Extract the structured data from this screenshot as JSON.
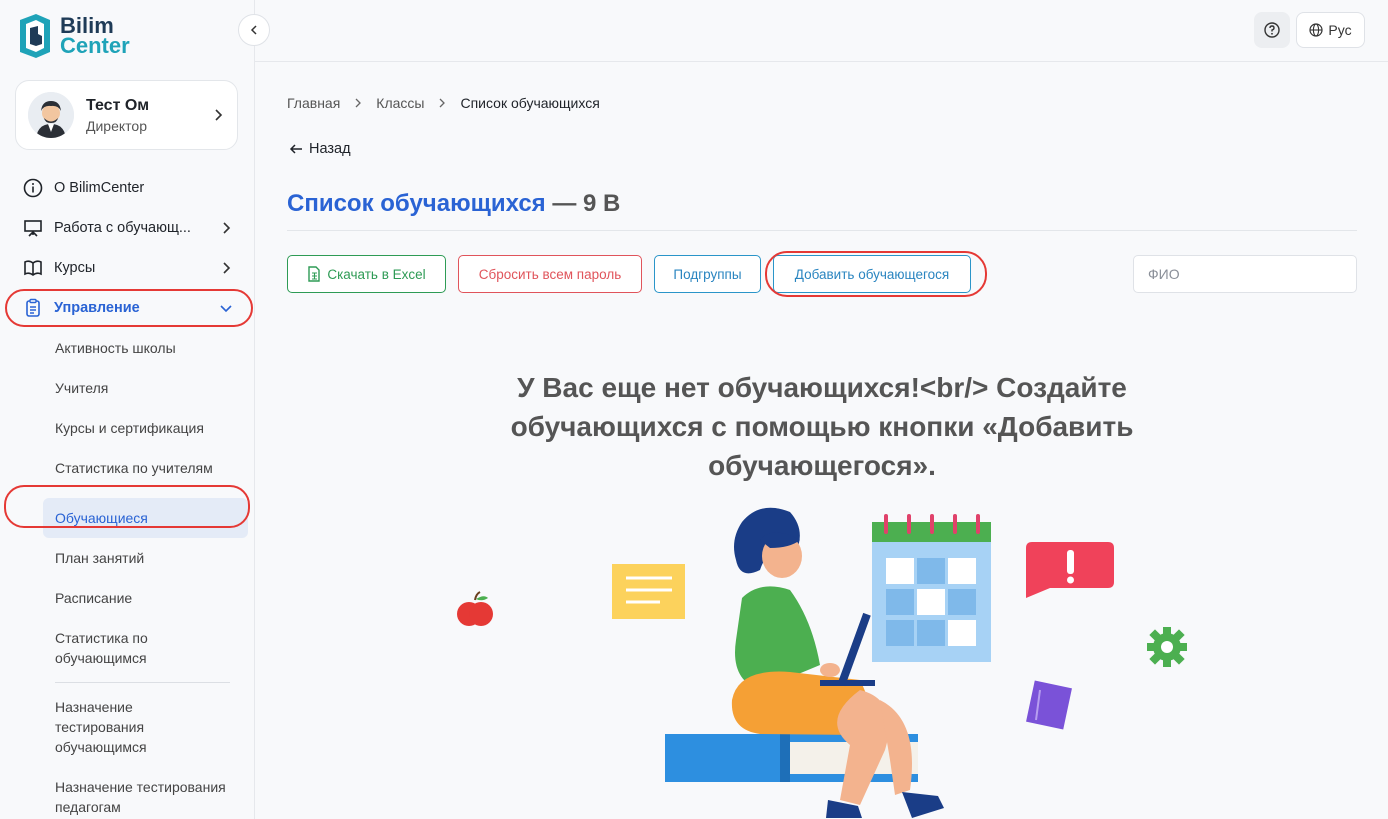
{
  "logo": {
    "line1": "Bilim",
    "line2": "Center"
  },
  "profile": {
    "name": "Тест Ом",
    "role": "Директор"
  },
  "nav": {
    "about": "О BilimCenter",
    "students_work": "Работа с обучающ...",
    "courses": "Курсы",
    "management": "Управление"
  },
  "sub": {
    "school_activity": "Активность школы",
    "teachers": "Учителя",
    "courses_cert": "Курсы и сертификация",
    "teacher_stats": "Статистика по учителям",
    "students": "Обучающиеся",
    "lesson_plan": "План занятий",
    "schedule": "Расписание",
    "student_stats": "Статистика по обучающимся",
    "assign_students": "Назначение тестирования обучающимся",
    "assign_teachers": "Назначение тестирования педагогам"
  },
  "topbar": {
    "lang": "Рус"
  },
  "breadcrumb": {
    "home": "Главная",
    "classes": "Классы",
    "current": "Список обучающихся"
  },
  "back_label": "Назад",
  "page_title": {
    "main": "Список обучающихся",
    "suffix": "— 9 В"
  },
  "actions": {
    "excel": "Скачать в Excel",
    "reset": "Сбросить всем пароль",
    "subgroups": "Подгруппы",
    "add": "Добавить обучающегося"
  },
  "search": {
    "placeholder": "ФИО"
  },
  "empty_message": "У Вас еще нет обучающихся!<br/> Создайте обучающихся с помощью кнопки «Добавить обучающегося».",
  "colors": {
    "primary": "#2a63d4",
    "danger": "#e0545b",
    "success": "#2e9b55",
    "highlight_ring": "#e53935"
  }
}
